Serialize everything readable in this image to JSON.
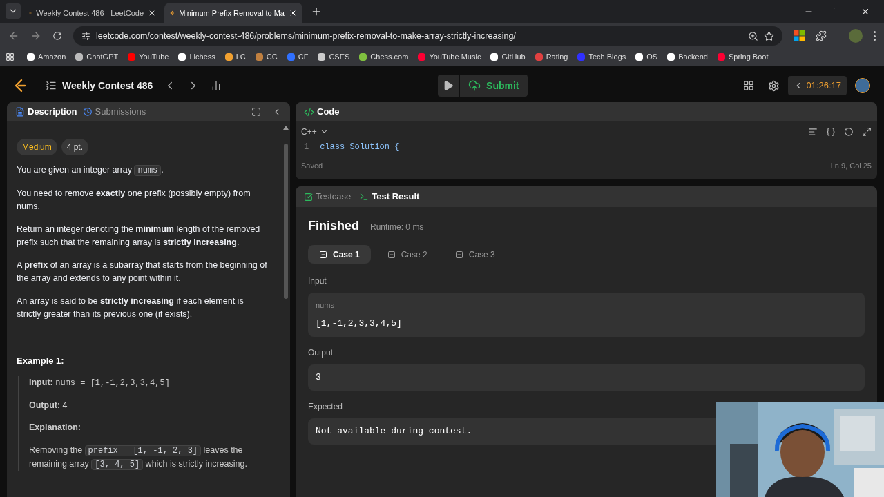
{
  "browser": {
    "tabs": [
      {
        "title": "Weekly Contest 486 - LeetCode",
        "selected": false
      },
      {
        "title": "Minimum Prefix Removal to Ma",
        "selected": true
      }
    ],
    "url": "leetcode.com/contest/weekly-contest-486/problems/minimum-prefix-removal-to-make-array-strictly-increasing/",
    "bookmarks": [
      "Amazon",
      "ChatGPT",
      "YouTube",
      "Lichess",
      "LC",
      "CC",
      "CF",
      "CSES",
      "Chess.com",
      "YouTube Music",
      "GitHub",
      "Rating",
      "Tech Blogs",
      "OS",
      "Backend",
      "Spring Boot"
    ]
  },
  "header": {
    "title": "Weekly Contest 486",
    "submit": "Submit",
    "timer": "01:26:17"
  },
  "left_panel": {
    "tabs": [
      {
        "label": "Description",
        "selected": true
      },
      {
        "label": "Submissions",
        "selected": false
      }
    ],
    "tags": [
      {
        "label": "Medium",
        "kind": "difficulty"
      },
      {
        "label": "4 pt.",
        "kind": "points"
      }
    ],
    "paragraphs": [
      [
        {
          "kind": "text",
          "text": "You are given an integer array "
        },
        {
          "kind": "code",
          "text": "nums"
        },
        {
          "kind": "text",
          "text": "."
        }
      ],
      [
        {
          "kind": "text",
          "text": "You need to remove **exactly** one prefix (possibly empty) from nums."
        }
      ],
      [
        {
          "kind": "text",
          "text": "Return an integer denoting the **minimum** length of the removed prefix such that the remaining array is **strictly increasing**."
        }
      ],
      [
        {
          "kind": "text",
          "text": "A **prefix** of an array is a subarray that starts from the beginning of the array and extends to any point within it."
        }
      ],
      [
        {
          "kind": "text",
          "text": "An array is said to be **strictly increasing** if each element is strictly greater than its previous one (if exists)."
        }
      ]
    ],
    "example": {
      "title": "Example 1:",
      "input_label": "Input:",
      "input": "nums = ",
      "input_code": "[1,-1,2,3,3,4,5]",
      "output_label": "Output:",
      "output": "4",
      "explanation_label": "Explanation:",
      "explanation": [
        {
          "kind": "text",
          "text": "Removing the "
        },
        {
          "kind": "code",
          "text": "prefix = [1, -1, 2, 3]"
        },
        {
          "kind": "text",
          "text": " leaves the remaining array "
        },
        {
          "kind": "code",
          "text": "[3, 4, 5]"
        },
        {
          "kind": "text",
          "text": " which is strictly increasing."
        }
      ]
    }
  },
  "code_panel": {
    "title": "Code",
    "language": "C++",
    "line_number": "1",
    "code_line": "class Solution {",
    "status": "Saved",
    "cursor": "Ln 9, Col 25"
  },
  "result_panel": {
    "tabs": [
      {
        "label": "Testcase",
        "selected": false
      },
      {
        "label": "Test Result",
        "selected": true
      }
    ],
    "status": "Finished",
    "runtime": "Runtime: 0 ms",
    "cases": [
      {
        "label": "Case 1",
        "selected": true
      },
      {
        "label": "Case 2",
        "selected": false
      },
      {
        "label": "Case 3",
        "selected": false
      }
    ],
    "input_label": "Input",
    "var_name": "nums =",
    "input_value": "[1,-1,2,3,3,4,5]",
    "output_label": "Output",
    "output_value": "3",
    "expected_label": "Expected",
    "expected_value": "Not available during contest."
  }
}
